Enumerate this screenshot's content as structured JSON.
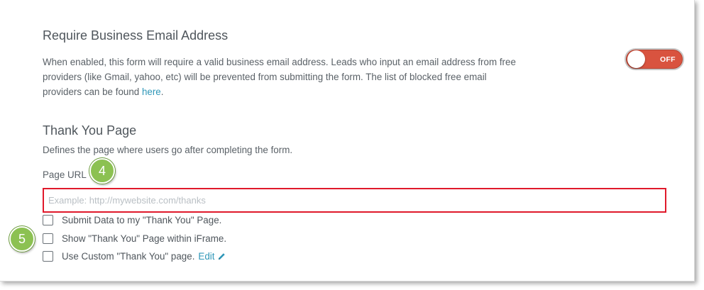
{
  "business_email": {
    "title": "Require Business Email Address",
    "description": "When enabled, this form will require a valid business email address. Leads who input an email address from free providers (like Gmail, yahoo, etc) will be prevented from submitting the form. The list of blocked free email providers can be found ",
    "link_text": "here",
    "description_end": ".",
    "toggle_state": "OFF"
  },
  "thank_you": {
    "title": "Thank You Page",
    "description": "Defines the page where users go after completing the form.",
    "url_label": "Page URL",
    "url_placeholder": "Example: http://mywebsite.com/thanks",
    "url_value": "",
    "options": [
      {
        "label": "Submit Data to my \"Thank You\" Page.",
        "checked": false
      },
      {
        "label": "Show \"Thank You\" Page within iFrame.",
        "checked": false
      },
      {
        "label": "Use Custom \"Thank You\" page.",
        "checked": false
      }
    ],
    "edit_label": "Edit"
  },
  "annotations": {
    "badge_4": "4",
    "badge_5": "5"
  },
  "colors": {
    "accent_link": "#2f97b8",
    "toggle_off": "#d9533f",
    "highlight_border": "#e0192b",
    "badge_green": "#8cc152"
  }
}
